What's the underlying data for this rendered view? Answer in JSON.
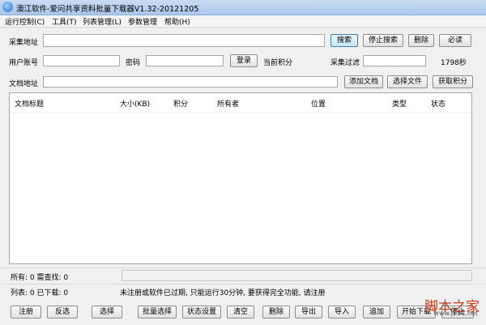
{
  "window": {
    "title": "澳江软件-爱问共享资料批量下载器V1.32-20121205"
  },
  "menu": [
    "运行控制(C)",
    "工具(T)",
    "列表管理(L)",
    "参数管理",
    "帮助(H)"
  ],
  "form": {
    "collect_addr_label": "采集地址",
    "user_label": "用户账号",
    "pwd_label": "密码",
    "current_points_label": "当前积分",
    "collect_filter_label": "采集过滤",
    "timer_value": "1798秒",
    "doc_addr_label": "文档地址"
  },
  "buttons": {
    "search": "搜索",
    "stop_search": "停止搜索",
    "delete": "删除",
    "must_read": "必读",
    "login": "登录",
    "add_doc": "添加文档",
    "select_file": "选择文件",
    "get_points": "获取积分"
  },
  "table": {
    "columns": [
      "文档标题",
      "大小(KB)",
      "积分",
      "所有者",
      "位置",
      "类型",
      "状态"
    ]
  },
  "status": {
    "line1": "所有: 0 需查找: 0",
    "line2": "列表: 0 已下载: 0",
    "message": "未注册或软件已过期, 只能运行30分钟, 要获得完全功能, 请注册"
  },
  "bottom_buttons": [
    "注册",
    "反选",
    "选择",
    "批量选择",
    "状态设置",
    "清空",
    "删除",
    "导出",
    "导入",
    "追加",
    "开始下载",
    "停止"
  ],
  "watermark": {
    "main": "脚本之家",
    "sub": "www.jb51.net"
  }
}
